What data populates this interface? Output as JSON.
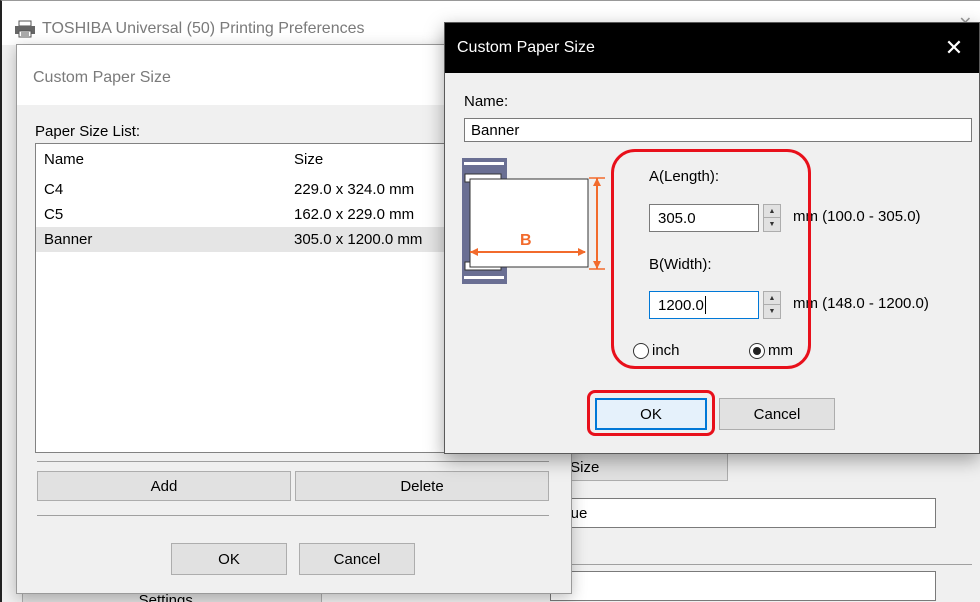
{
  "bg_window": {
    "title": "TOSHIBA Universal (50) Printing Preferences",
    "close_glyph": "✕",
    "paper_size_btn": "r Size",
    "field_1": "Que",
    "settings_btn": "Settings..."
  },
  "list_dialog": {
    "title": "Custom Paper Size",
    "list_label": "Paper Size List:",
    "columns": {
      "name": "Name",
      "size": "Size"
    },
    "rows": [
      {
        "name": "C4",
        "size": "229.0 x 324.0 mm"
      },
      {
        "name": "C5",
        "size": "162.0 x 229.0 mm"
      },
      {
        "name": "Banner",
        "size": "305.0 x 1200.0 mm"
      }
    ],
    "selected_row": 2,
    "add_btn": "Add",
    "delete_btn": "Delete",
    "ok_btn": "OK",
    "cancel_btn": "Cancel"
  },
  "edit_dialog": {
    "title": "Custom Paper Size",
    "close_glyph": "✕",
    "name_label": "Name:",
    "name_value": "Banner",
    "diagram_label": "B",
    "a_label": "A(Length):",
    "a_value": "305.0",
    "a_range": "mm (100.0 - 305.0)",
    "b_label": "B(Width):",
    "b_value": "1200.0",
    "b_range": "mm (148.0 - 1200.0)",
    "unit_inch": "inch",
    "unit_mm": "mm",
    "selected_unit": "mm",
    "ok_btn": "OK",
    "cancel_btn": "Cancel"
  },
  "colors": {
    "annotation": "#e8101b",
    "diagram_arrow": "#f26b2c",
    "focus_blue": "#0078d7",
    "titlebar": "#000000"
  }
}
